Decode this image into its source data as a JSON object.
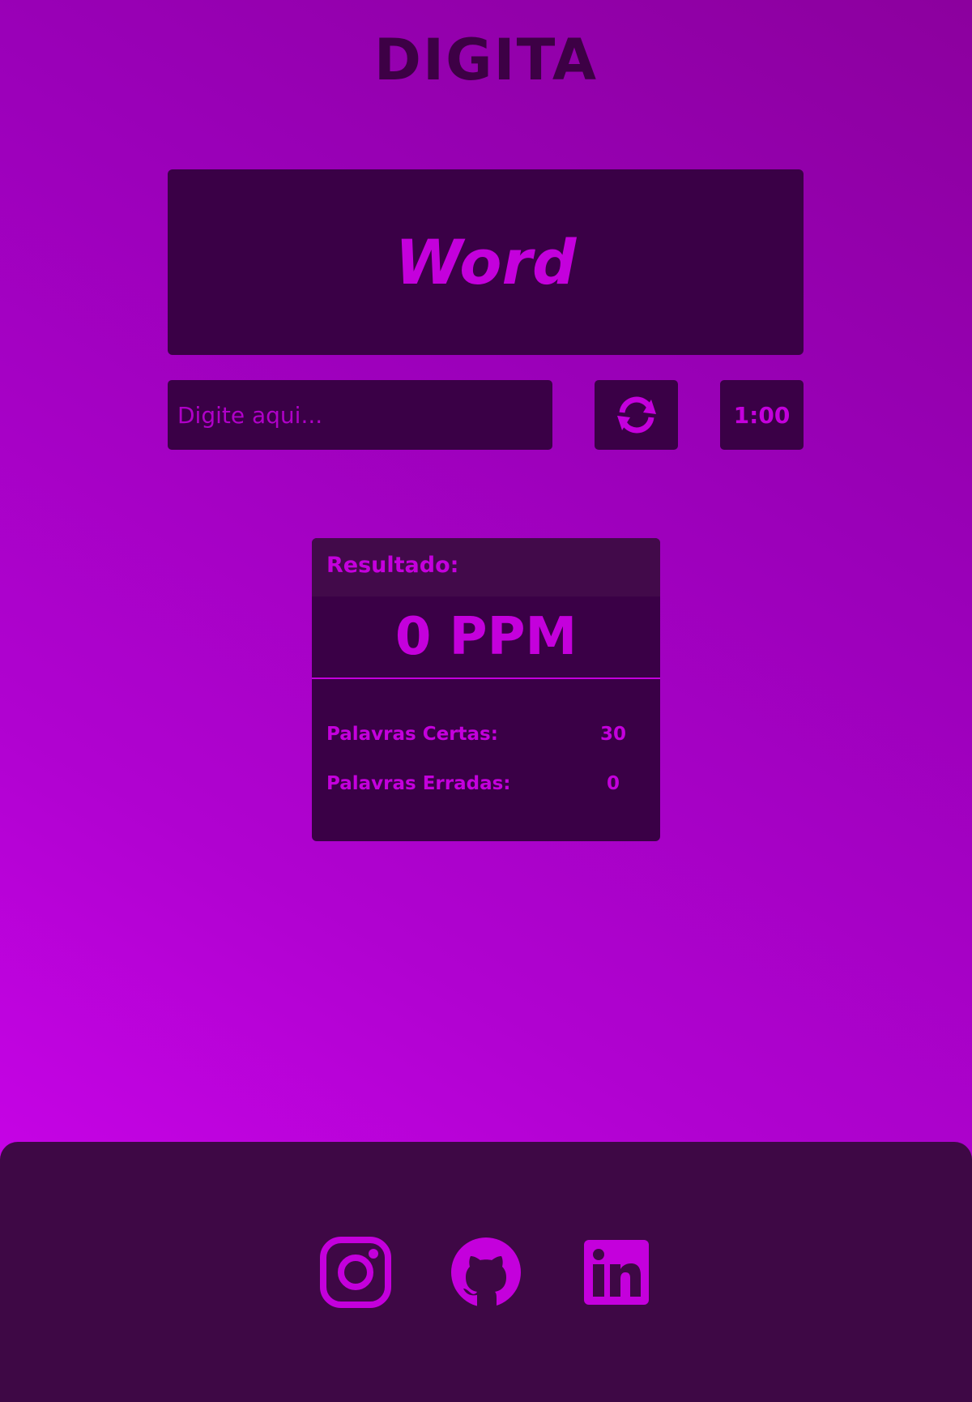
{
  "app": {
    "title": "DIGITA"
  },
  "typing": {
    "current_word": "Word",
    "input_placeholder": "Digite aqui...",
    "input_value": "",
    "timer": "1:00",
    "refresh_icon": "refresh-icon"
  },
  "result": {
    "header": "Resultado:",
    "ppm": "0 PPM",
    "correct_label": "Palavras Certas:",
    "correct_value": "30",
    "wrong_label": "Palavras Erradas:",
    "wrong_value": "0"
  },
  "footer": {
    "links": [
      {
        "icon": "instagram-icon"
      },
      {
        "icon": "github-icon"
      },
      {
        "icon": "linkedin-icon"
      }
    ]
  },
  "colors": {
    "background_gradient": [
      "#d104f0",
      "#8c009e"
    ],
    "panel": "#3a0046",
    "accent": "#c400dc",
    "footer": "#3e0845"
  }
}
